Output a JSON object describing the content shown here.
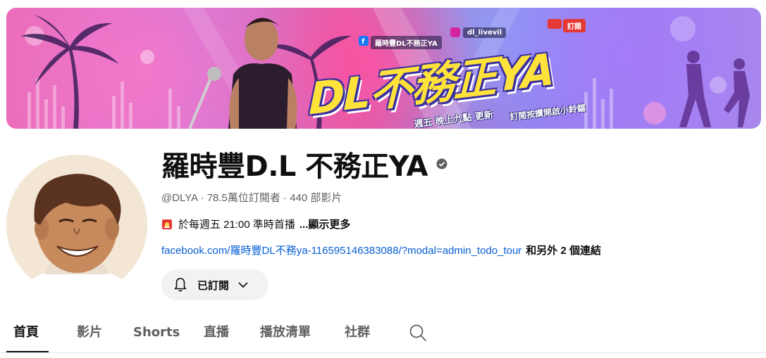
{
  "banner": {
    "logo_text": "DL不務正YA",
    "facebook_label": "羅時豐DL不務正YA",
    "instagram_label": "dl_livevil",
    "subscribe_badge": "訂閱",
    "schedule_text": "週五 晚上九點 更新",
    "reminder_text": "訂閱按讚開啟小鈴鐺"
  },
  "channel": {
    "title": "羅時豐D.L 不務正YA",
    "verified": true,
    "meta": "@DLYA · 78.5萬位訂閱者 · 440 部影片",
    "description": "於每週五 21:00 準時首播",
    "more_label": "...顯示更多",
    "link_url": "facebook.com/羅時豐DL不務ya-116595146383088/?modal=admin_todo_tour",
    "other_links": "和另外 2 個連結"
  },
  "subscribe": {
    "label": "已訂閱",
    "icon": "bell-icon",
    "dropdown_icon": "chevron-down-icon"
  },
  "tabs": [
    {
      "label": "首頁",
      "active": true
    },
    {
      "label": "影片",
      "active": false
    },
    {
      "label": "Shorts",
      "active": false
    },
    {
      "label": "直播",
      "active": false
    },
    {
      "label": "播放清單",
      "active": false
    },
    {
      "label": "社群",
      "active": false
    }
  ],
  "tab_search_icon": "search-icon",
  "colors": {
    "link": "#065fd4",
    "text_primary": "#0f0f0f",
    "text_secondary": "#606060",
    "button_bg": "#f2f2f2",
    "banner_logo": "#ffe23a"
  }
}
